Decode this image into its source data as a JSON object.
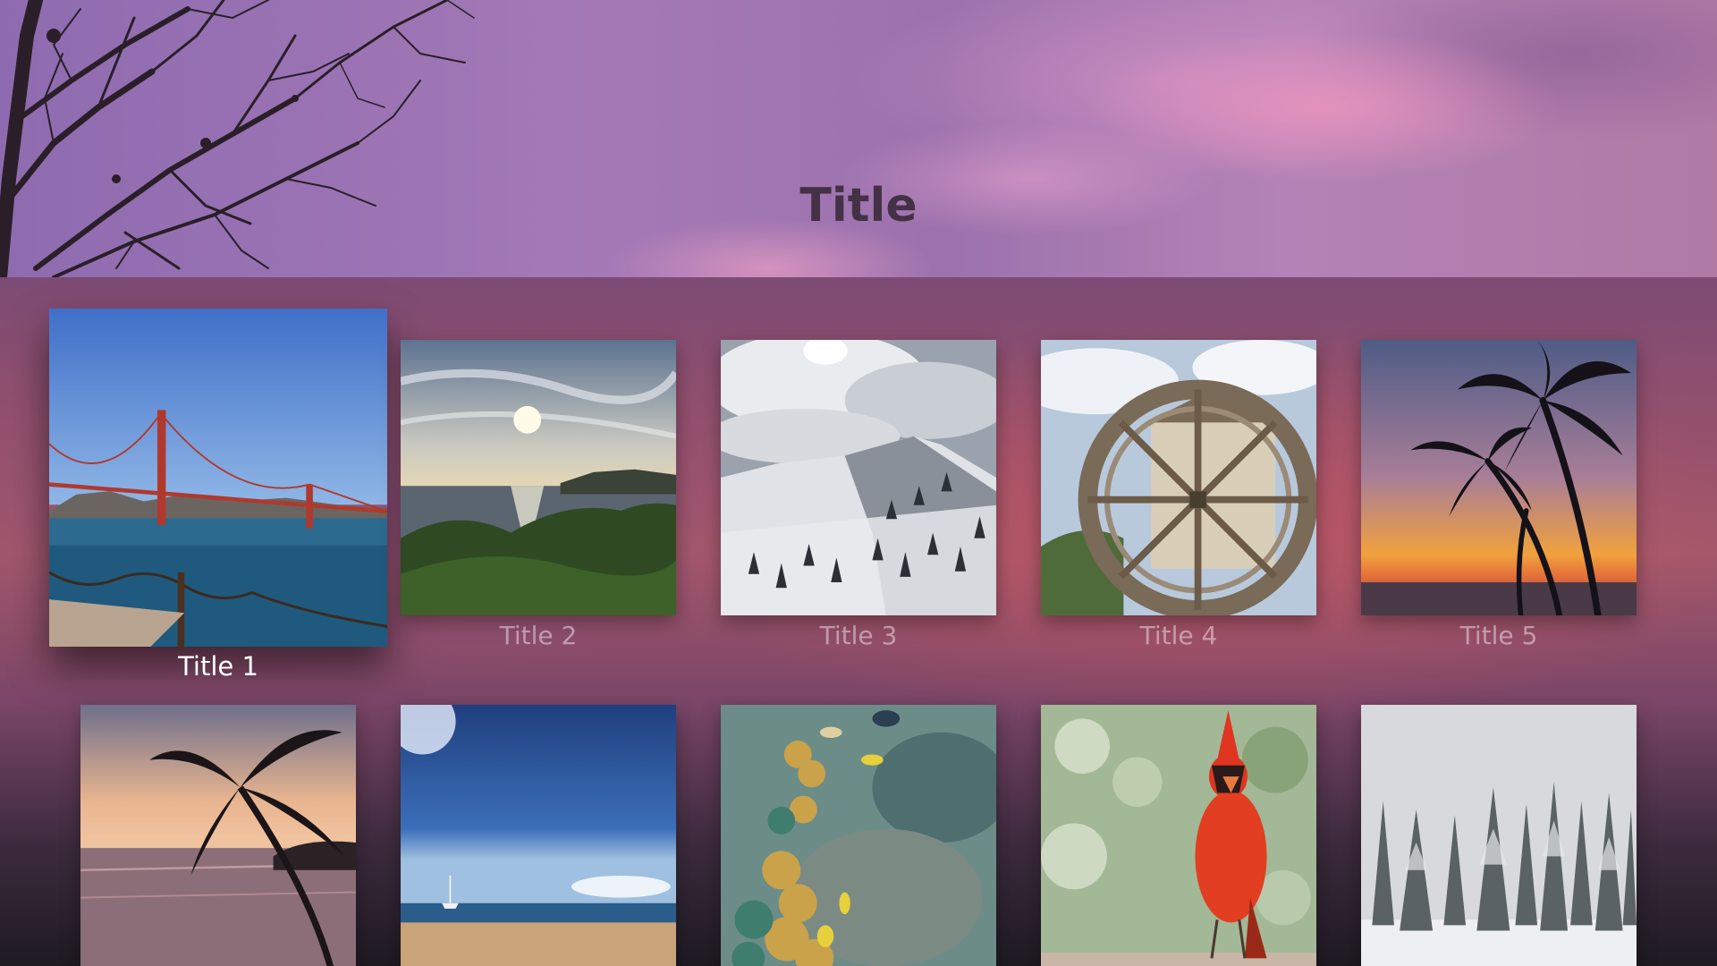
{
  "header": {
    "title": "Title"
  },
  "grid": {
    "items": [
      {
        "label": "Title 1",
        "image": "golden-gate-bridge-photo"
      },
      {
        "label": "Title 2",
        "image": "coastal-sunset-photo"
      },
      {
        "label": "Title 3",
        "image": "snowy-mountain-photo"
      },
      {
        "label": "Title 4",
        "image": "water-wheel-photo"
      },
      {
        "label": "Title 5",
        "image": "palm-trees-sunset-photo"
      },
      {
        "label": "",
        "image": "palm-tree-beach-photo"
      },
      {
        "label": "",
        "image": "sunny-beach-photo"
      },
      {
        "label": "",
        "image": "coral-reef-photo"
      },
      {
        "label": "",
        "image": "cardinal-bird-photo"
      },
      {
        "label": "",
        "image": "snowy-forest-photo"
      }
    ]
  }
}
